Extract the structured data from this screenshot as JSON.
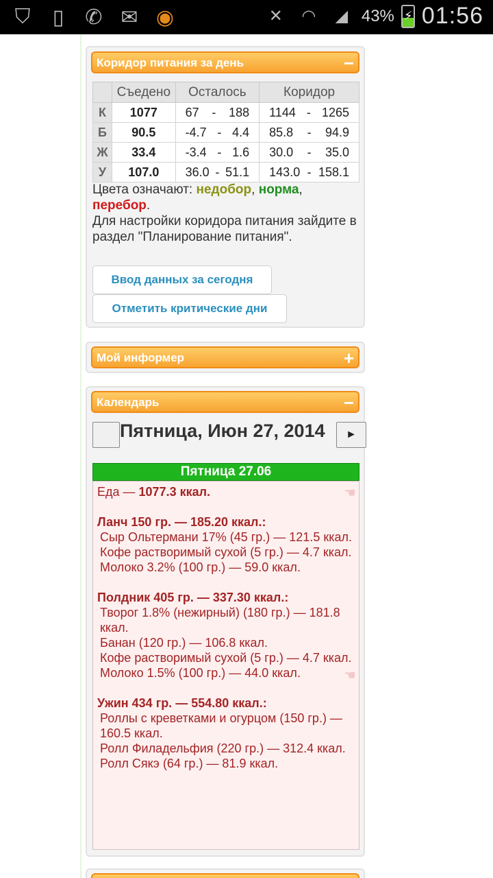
{
  "status_bar": {
    "battery": "43%",
    "time": "01:56"
  },
  "corridor": {
    "title": "Коридор питания за день",
    "toggle": "−",
    "headers": [
      "",
      "Съедено",
      "Осталось",
      "Коридор"
    ],
    "rows": [
      {
        "label": "К",
        "eaten": "1077",
        "left_from": "67",
        "left_to": "188",
        "corr_from": "1144",
        "corr_to": "1265",
        "state": "under"
      },
      {
        "label": "Б",
        "eaten": "90.5",
        "left_from": "-4.7",
        "left_to": "4.4",
        "corr_from": "85.8",
        "corr_to": "94.9",
        "state": "norm"
      },
      {
        "label": "Ж",
        "eaten": "33.4",
        "left_from": "-3.4",
        "left_to": "1.6",
        "corr_from": "30.0",
        "corr_to": "35.0",
        "state": "norm"
      },
      {
        "label": "У",
        "eaten": "107.0",
        "left_from": "36.0",
        "left_to": "51.1",
        "corr_from": "143.0",
        "corr_to": "158.1",
        "state": "under"
      }
    ],
    "dash": "-",
    "legend_prefix": "Цвета означают: ",
    "legend_under": "недобор",
    "legend_sep1": ", ",
    "legend_norm": "норма",
    "legend_sep2": ",",
    "legend_over": "перебор",
    "legend_end": ".",
    "note": "Для настройки коридора питания зайдите в раздел \"Планирование питания\".",
    "btn_today": "Ввод данных за сегодня",
    "btn_critical": "Отметить критические дни",
    "colors": {
      "under": "#8a9313",
      "norm": "#1f8f1f",
      "over": "#d11a1a"
    }
  },
  "informer": {
    "title": "Мой информер",
    "toggle": "+"
  },
  "calendar": {
    "title": "Календарь",
    "toggle": "−",
    "date_title": "Пятница, Июн 27, 2014",
    "next": "►",
    "day_header": "Пятница 27.06",
    "food_prefix": "Еда — ",
    "food_total": "1077.3 ккал.",
    "meals": [
      {
        "title": "Ланч 150 гр. — 185.20 ккал.:",
        "items": [
          "Сыр Ольтермани 17% (45 гр.) — 121.5 ккал.",
          "Кофе растворимый сухой (5 гр.) — 4.7 ккал.",
          "Молоко 3.2% (100 гр.) — 59.0 ккал."
        ]
      },
      {
        "title": "Полдник 405 гр. — 337.30 ккал.:",
        "items": [
          "Творог 1.8% (нежирный) (180 гр.) — 181.8 ккал.",
          "Банан (120 гр.) — 106.8 ккал.",
          "Кофе растворимый сухой (5 гр.) — 4.7 ккал.",
          "Молоко 1.5% (100 гр.) — 44.0 ккал."
        ]
      },
      {
        "title": "Ужин 434 гр. — 554.80 ккал.:",
        "items": [
          "Роллы с креветками и огурцом (150 гр.) — 160.5 ккал.",
          "Ролл Филадельфия (220 гр.) — 312.4 ккал.",
          "Ролл Сякэ (64 гр.) — 81.9 ккал."
        ]
      }
    ]
  }
}
